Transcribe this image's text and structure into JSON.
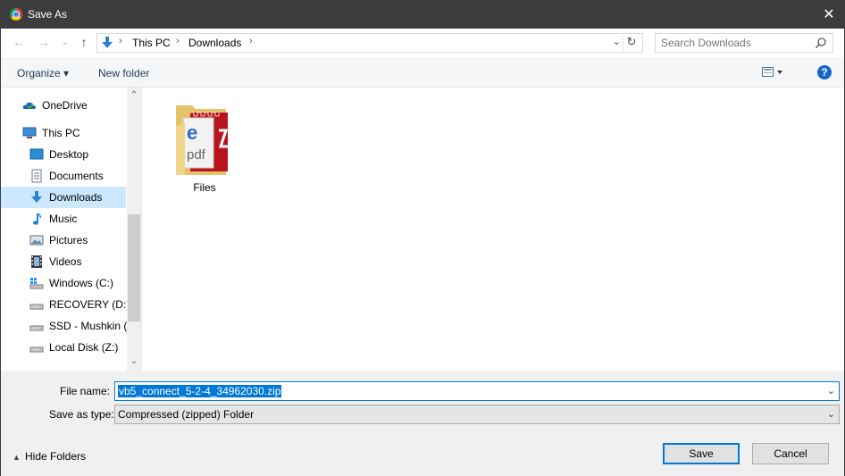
{
  "window": {
    "title": "Save As",
    "close_glyph": "✕"
  },
  "nav": {
    "back_glyph": "←",
    "forward_glyph": "→",
    "recent_glyph": "⌄",
    "up_glyph": "↑",
    "breadcrumbs": [
      "This PC",
      "Downloads"
    ],
    "refresh_glyph": "↻"
  },
  "search": {
    "placeholder": "Search Downloads"
  },
  "toolbar": {
    "organize_label": "Organize ▾",
    "new_folder_label": "New folder",
    "help_glyph": "?"
  },
  "sidebar": {
    "items": [
      {
        "label": "OneDrive",
        "icon": "onedrive-icon"
      },
      {
        "label": "This PC",
        "icon": "this-pc-icon"
      },
      {
        "label": "Desktop",
        "icon": "desktop-icon"
      },
      {
        "label": "Documents",
        "icon": "documents-icon"
      },
      {
        "label": "Downloads",
        "icon": "downloads-icon",
        "selected": true
      },
      {
        "label": "Music",
        "icon": "music-icon"
      },
      {
        "label": "Pictures",
        "icon": "pictures-icon"
      },
      {
        "label": "Videos",
        "icon": "videos-icon"
      },
      {
        "label": "Windows (C:)",
        "icon": "drive-c-icon"
      },
      {
        "label": "RECOVERY (D:)",
        "icon": "drive-icon"
      },
      {
        "label": "SSD - Mushkin (I",
        "icon": "drive-icon"
      },
      {
        "label": "Local Disk (Z:)",
        "icon": "drive-icon"
      }
    ]
  },
  "content": {
    "items": [
      {
        "label": "Files",
        "type": "folder"
      }
    ]
  },
  "form": {
    "file_name_label": "File name:",
    "file_name_value": "vb5_connect_5-2-4_34962030.zip",
    "save_type_label": "Save as type:",
    "save_type_value": "Compressed (zipped) Folder"
  },
  "footer": {
    "hide_folders_label": "Hide Folders",
    "save_label": "Save",
    "cancel_label": "Cancel"
  },
  "colors": {
    "titlebar": "#3c3c3c",
    "selection": "#cce8ff",
    "accent": "#0078d7"
  }
}
